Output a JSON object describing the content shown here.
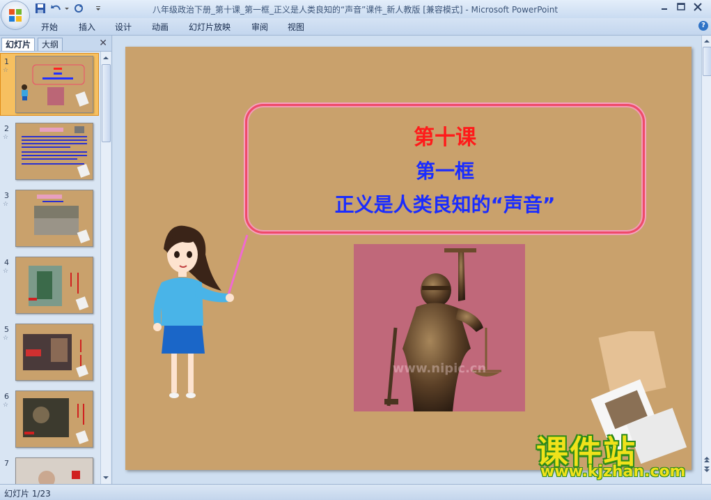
{
  "window": {
    "title": "八年级政治下册_第十课_第一框_正义是人类良知的“声音”课件_新人教版 [兼容模式] - Microsoft PowerPoint"
  },
  "ribbon": {
    "tabs": [
      "开始",
      "插入",
      "设计",
      "动画",
      "幻灯片放映",
      "审阅",
      "视图"
    ]
  },
  "left_pane": {
    "tabs": [
      "幻灯片",
      "大纲"
    ],
    "close_glyph": "✕",
    "slides": [
      {
        "num": "1",
        "selected": true
      },
      {
        "num": "2",
        "selected": false
      },
      {
        "num": "3",
        "selected": false
      },
      {
        "num": "4",
        "selected": false
      },
      {
        "num": "5",
        "selected": false
      },
      {
        "num": "6",
        "selected": false
      },
      {
        "num": "7",
        "selected": false
      }
    ],
    "star_glyph": "☆"
  },
  "slide": {
    "title_line1": "第十课",
    "title_line2": "第一框",
    "title_line3": "正义是人类良知的“声音”",
    "statue_watermark": "www.nipic.cn",
    "background_color": "#c9a16c"
  },
  "overlay": {
    "site_name": "课件站",
    "site_url": "www.kjzhan.com"
  },
  "status_bar": {
    "text": "幻灯片 1/23"
  },
  "icons": [
    "office-button-icon",
    "save-icon",
    "undo-icon",
    "redo-icon",
    "customize-qat-icon",
    "minimize-icon",
    "maximize-icon",
    "close-icon",
    "help-icon"
  ]
}
